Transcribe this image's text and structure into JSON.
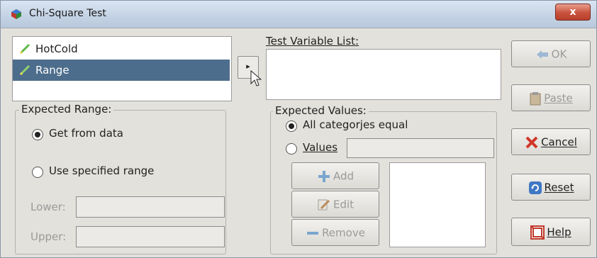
{
  "window": {
    "title": "Chi-Square Test",
    "close_label": "x"
  },
  "variables": [
    {
      "label": "HotCold",
      "selected": false
    },
    {
      "label": "Range",
      "selected": true
    }
  ],
  "move_button": {
    "label": "▸"
  },
  "test_variable_list": {
    "label": "Test Variable List:"
  },
  "expected_range": {
    "title": "Expected Range:",
    "get_from_data": {
      "label": "Get from data",
      "checked": true
    },
    "use_specified": {
      "label": "Use specified range",
      "checked": false
    },
    "lower_label": "Lower:",
    "upper_label": "Upper:",
    "lower_value": "",
    "upper_value": ""
  },
  "expected_values": {
    "title": "Expected Values:",
    "all_equal": {
      "label": "All categorjes equal",
      "checked": true
    },
    "values": {
      "label": "Values",
      "checked": false,
      "value": ""
    },
    "add_label": "Add",
    "edit_label": "Edit",
    "remove_label": "Remove"
  },
  "buttons": {
    "ok": "OK",
    "paste": "Paste",
    "cancel": "Cancel",
    "reset": "Reset",
    "help": "Help"
  },
  "colors": {
    "selection": "#4d6d8c",
    "cancel_icon": "#d0362a",
    "accent_green": "#5fb84a"
  }
}
